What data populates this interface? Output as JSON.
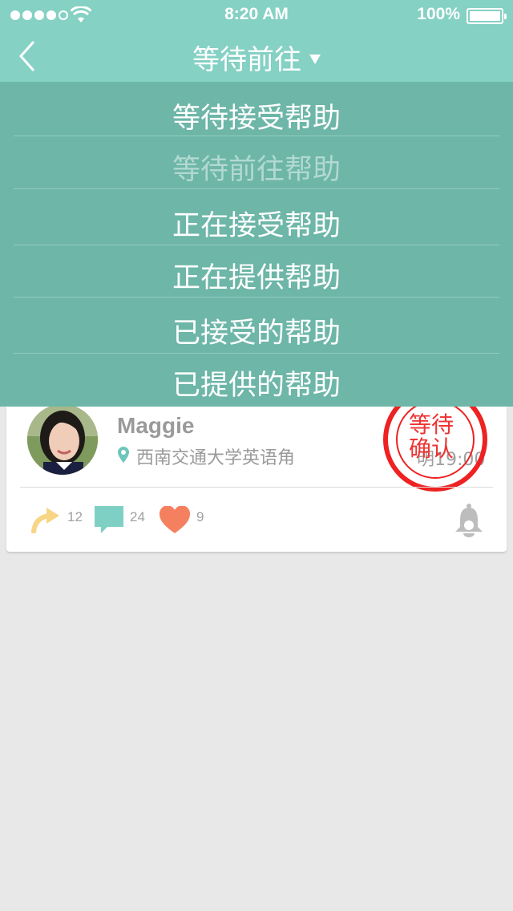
{
  "status_bar": {
    "time": "8:20 AM",
    "battery": "100%"
  },
  "nav": {
    "title": "等待前往"
  },
  "menu": {
    "items": [
      {
        "label": "等待接受帮助",
        "selected": false
      },
      {
        "label": "等待前往帮助",
        "selected": true
      },
      {
        "label": "正在接受帮助",
        "selected": false
      },
      {
        "label": "正在提供帮助",
        "selected": false
      },
      {
        "label": "已接受的帮助",
        "selected": false
      },
      {
        "label": "已提供的帮助",
        "selected": false
      }
    ]
  },
  "card": {
    "user_name": "Maggie",
    "location": "西南交通大学英语角",
    "time": "明19:00",
    "stamp": "等待确认",
    "shares": "12",
    "comments": "24",
    "likes": "9"
  },
  "colors": {
    "nav_bg": "#85d1c4",
    "menu_bg": "#6db6a8",
    "stamp": "#e22222",
    "share": "#f7d585",
    "comment": "#7fd0c4",
    "heart": "#f58060"
  }
}
